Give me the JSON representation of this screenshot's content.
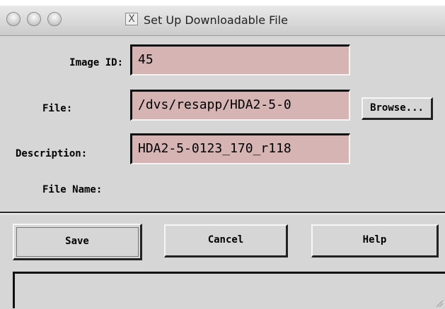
{
  "window": {
    "title": "Set Up Downloadable File",
    "close_glyph": "X"
  },
  "fields": {
    "image_id": {
      "label": "Image ID:",
      "value": "45"
    },
    "file": {
      "label": "File:",
      "value": "/dvs/resapp/HDA2-5-0"
    },
    "description": {
      "label": "Description:",
      "value": "HDA2-5-0123_170_r118"
    },
    "file_name": {
      "label": "File Name:",
      "value": ""
    }
  },
  "buttons": {
    "browse": "Browse...",
    "save": "Save",
    "cancel": "Cancel",
    "help": "Help"
  },
  "status": {
    "text": ""
  },
  "colors": {
    "field_bg": "#d6b4b4",
    "window_bg": "#d6d6d6"
  },
  "icons": [
    "close-window-icon",
    "traffic-light-close-icon",
    "traffic-light-minimize-icon",
    "traffic-light-zoom-icon",
    "resize-grip-icon"
  ]
}
